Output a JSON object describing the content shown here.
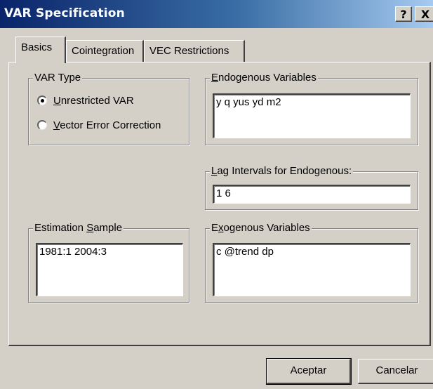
{
  "window": {
    "title": "VAR Specification",
    "help_label": "?",
    "close_label": "X"
  },
  "tabs": [
    {
      "label": "Basics",
      "active": true
    },
    {
      "label": "Cointegration",
      "active": false
    },
    {
      "label": "VEC Restrictions",
      "active": false
    }
  ],
  "var_type": {
    "legend": "VAR Type",
    "options": [
      {
        "label": "Unrestricted VAR",
        "mnemonic": "U",
        "rest": "nrestricted VAR",
        "selected": true
      },
      {
        "label": "Vector Error Correction",
        "mnemonic": "V",
        "rest": "ector Error Correction",
        "selected": false
      }
    ]
  },
  "endogenous": {
    "legend": "Endogenous Variables",
    "mnemonic": "E",
    "legend_rest": "ndogenous Variables",
    "value": "y q yus yd m2"
  },
  "lag_intervals": {
    "legend": "Lag Intervals for Endogenous:",
    "mnemonic": "L",
    "legend_rest": "ag Intervals for Endogenous:",
    "value": "1 6"
  },
  "estimation_sample": {
    "legend": "Estimation Sample",
    "legend_pre": "Estimation ",
    "mnemonic": "S",
    "legend_rest": "ample",
    "value": "1981:1 2004:3"
  },
  "exogenous": {
    "legend": "Exogenous Variables",
    "legend_pre": "E",
    "mnemonic": "x",
    "legend_rest": "ogenous Variables",
    "value": "c @trend dp"
  },
  "buttons": {
    "ok": "Aceptar",
    "cancel": "Cancelar"
  }
}
